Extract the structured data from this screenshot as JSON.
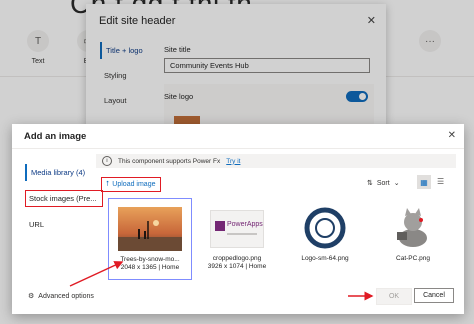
{
  "background": {
    "heading": "Ch             t   dd t  thi   th",
    "tools": [
      {
        "icon": "text-icon",
        "label": "Text"
      },
      {
        "icon": "button-icon",
        "label": "Bu"
      },
      {
        "icon": "more-icon",
        "label": ""
      }
    ]
  },
  "header_panel": {
    "title": "Edit site header",
    "nav": [
      "Title + logo",
      "Styling",
      "Layout"
    ],
    "site_title_label": "Site title",
    "site_title_value": "Community Events Hub",
    "site_logo_label": "Site logo",
    "site_logo_toggle_on": true
  },
  "dialog": {
    "title": "Add an image",
    "nav": [
      "Media library (4)",
      "Stock images (Pre...",
      "URL"
    ],
    "info_text": "This component supports Power Fx",
    "info_link": "Try it",
    "upload_label": "Upload image",
    "sort_label": "Sort",
    "tiles": [
      {
        "name": "Trees-by-snow-mo...",
        "meta": "2048 x 1365 | Home",
        "selected": true,
        "thumb": "photo"
      },
      {
        "name": "croppedlogo.png",
        "meta": "3926 x 1074 | Home",
        "selected": false,
        "thumb": "powerapps-logo",
        "thumb_text": "PowerApps"
      },
      {
        "name": "Logo-sm-64.png",
        "meta": "",
        "selected": false,
        "thumb": "ring-logo"
      },
      {
        "name": "Cat-PC.png",
        "meta": "",
        "selected": false,
        "thumb": "cat"
      }
    ],
    "advanced_label": "Advanced options",
    "ok_label": "OK",
    "cancel_label": "Cancel"
  },
  "colors": {
    "accent": "#0f6cbd",
    "annotation": "#e01b24"
  }
}
